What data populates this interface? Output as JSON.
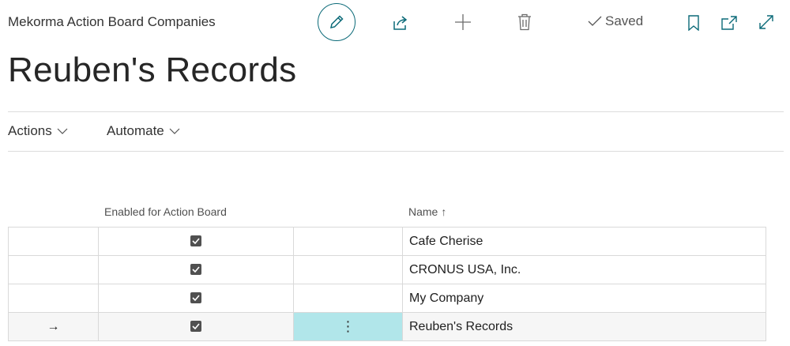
{
  "header": {
    "app_title": "Mekorma Action Board Companies",
    "saved_label": "Saved",
    "icons": [
      "edit-icon",
      "share-icon",
      "new-icon",
      "delete-icon",
      "check-icon",
      "bookmark-icon",
      "popout-icon",
      "expand-icon"
    ]
  },
  "page": {
    "title": "Reuben's Records"
  },
  "menu": {
    "actions": "Actions",
    "automate": "Automate"
  },
  "table": {
    "columns": {
      "enabled": "Enabled for Action Board",
      "name": "Name",
      "sort": "↑"
    },
    "rows": [
      {
        "enabled": true,
        "name": "Cafe Cherise",
        "indicator": "",
        "menu": ""
      },
      {
        "enabled": true,
        "name": "CRONUS USA, Inc.",
        "indicator": "",
        "menu": ""
      },
      {
        "enabled": true,
        "name": "My Company",
        "indicator": "",
        "menu": ""
      },
      {
        "enabled": true,
        "name": "Reuben's Records",
        "indicator": "→",
        "menu": "⋮"
      }
    ]
  },
  "colors": {
    "accent": "#0b6a78",
    "selected_cell": "#b1e6ea"
  }
}
